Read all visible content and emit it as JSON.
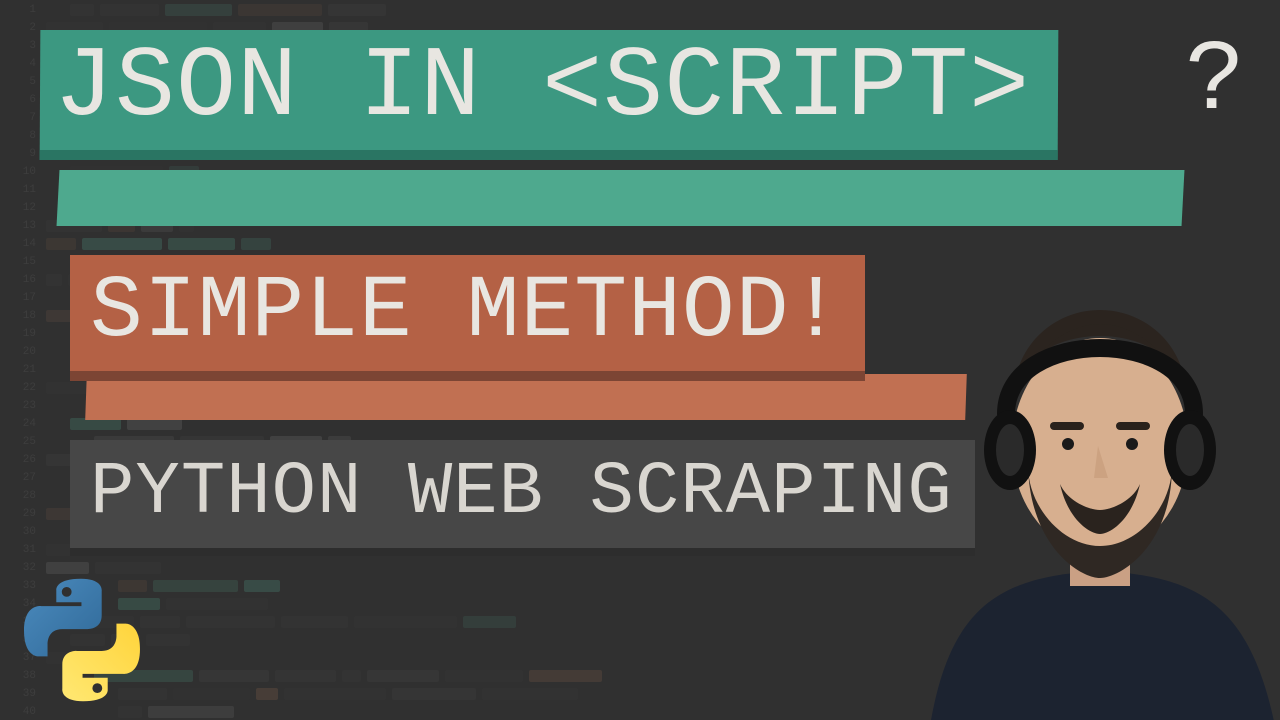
{
  "heading1_main": "JSON IN <SCRIPT>",
  "heading1_trail": "?",
  "heading2": "SIMPLE METHOD!",
  "heading3": "PYTHON WEB SCRAPING",
  "icons": {
    "python_logo": "python-logo-icon",
    "presenter": "presenter-photo"
  },
  "colors": {
    "bg": "#2f2f2f",
    "green": "#3c9881",
    "green_shade": "#2a7563",
    "orange": "#b46145",
    "orange_shade": "#7c4534",
    "gray": "#474747",
    "text": "#e8e6e1"
  }
}
